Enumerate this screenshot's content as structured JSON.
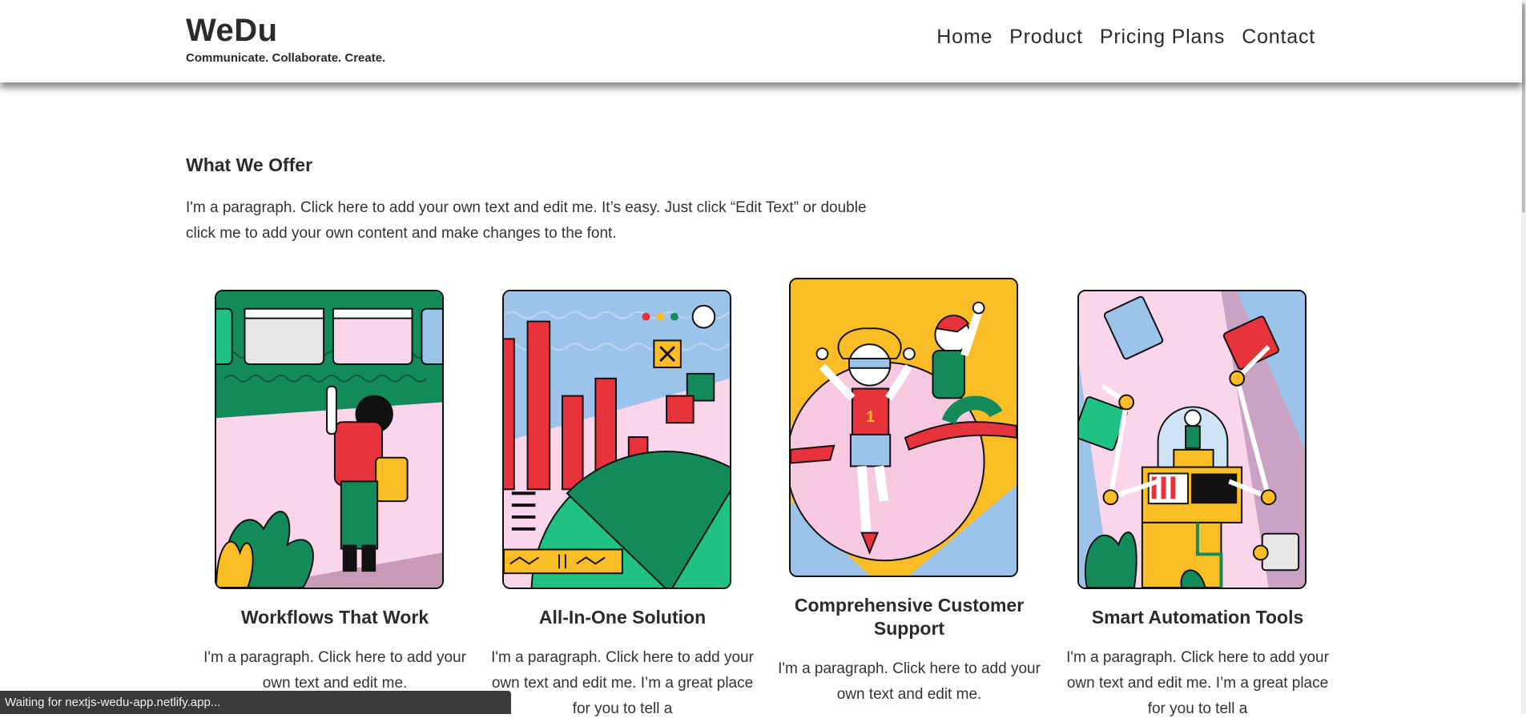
{
  "header": {
    "brand_name": "WeDu",
    "tagline": "Communicate. Collaborate. Create.",
    "nav": [
      "Home",
      "Product",
      "Pricing Plans",
      "Contact"
    ]
  },
  "offer": {
    "title": "What We Offer",
    "description": "I'm a paragraph. Click here to add your own text and edit me. It’s easy. Just click “Edit Text” or double click me to add your own content and make changes to the font."
  },
  "cards": [
    {
      "title": "Workflows That Work",
      "text": "I'm a paragraph. Click here to add your own text and edit me.",
      "illustration": "person-at-board-illustration"
    },
    {
      "title": "All-In-One Solution",
      "text": "I'm a paragraph. Click here to add your own text and edit me. I’m a great place for you to tell a",
      "illustration": "charts-illustration"
    },
    {
      "title": "Comprehensive Customer Support",
      "text": "I'm a paragraph. Click here to add your own text and edit me.",
      "illustration": "runner-finish-line-illustration"
    },
    {
      "title": "Smart Automation Tools",
      "text": "I'm a paragraph. Click here to add your own text and edit me. I’m a great place for you to tell a",
      "illustration": "robot-machine-illustration"
    }
  ],
  "status_bar": {
    "text": "Waiting for nextjs-wedu-app.netlify.app..."
  },
  "colors": {
    "green": "#138a5a",
    "pink": "#fbd6ea",
    "red": "#e8323c",
    "yellow": "#fbbd26",
    "blue": "#9cc3ea"
  }
}
